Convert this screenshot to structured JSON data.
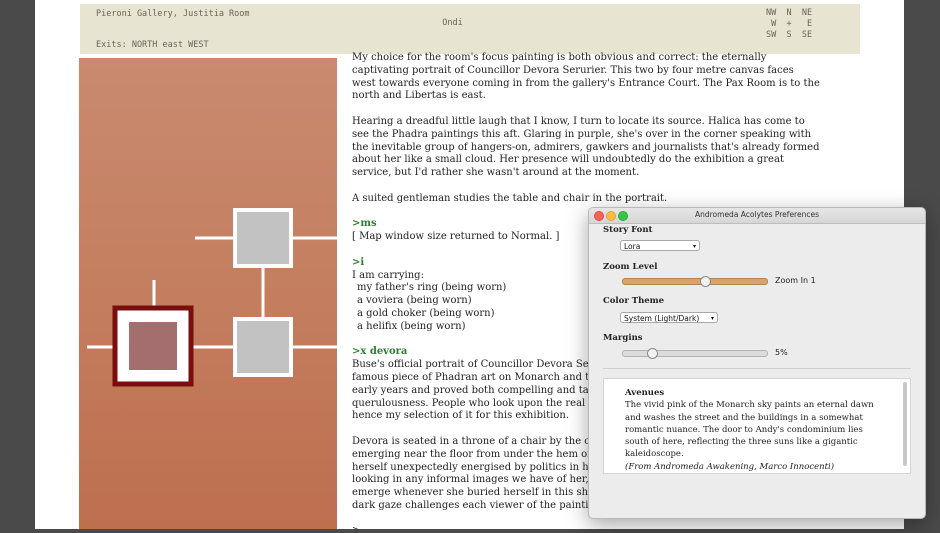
{
  "status": {
    "location": "Pieroni Gallery, Justitia Room",
    "time": "Ondi",
    "exits": "Exits: NORTH east WEST",
    "compass": [
      "NW  N  NE",
      " W  +   E",
      "SW  S  SE"
    ]
  },
  "story": {
    "p1": "My choice for the room's focus painting is both obvious and correct: the eternally captivating portrait of Councillor Devora Serurier. This two by four metre canvas faces west towards everyone coming in from the gallery's Entrance Court. The Pax Room is to the north and Libertas is east.",
    "p2": "Hearing a dreadful little laugh that I know, I turn to locate its source. Halica has come to see the Phadra paintings this aft. Glaring in purple, she's over in the corner speaking with the inevitable group of hangers-on, admirers, gawkers and journalists that's already formed about her like a small cloud. Her presence will undoubtedly do the exhibition a great service, but I'd rather she wasn't around at the moment.",
    "p3": "A suited gentleman studies the table and chair in the portrait.",
    "cmd1": ">ms",
    "resp1": "[ Map window size returned to Normal. ]",
    "cmd2": ">i",
    "inv_head": "I am carrying:",
    "inventory": [
      "my father's ring (being worn)",
      "a voviera (being worn)",
      "a gold choker (being worn)",
      "a helifix (being worn)"
    ],
    "cmd3": ">x devora",
    "devora1": [
      "Buse's official portrait of Councillor Devora Serurier, th",
      "famous piece of Phadran art on Monarch and the only f",
      "early years and proved both compelling and tasteful en",
      "querulousness. People who look upon the real painting",
      "hence my selection of it for this exhibition."
    ],
    "devora2": [
      "Devora is seated in a throne of a chair by the council tal",
      "emerging near the floor from under the hem of a specta",
      "herself unexpectedly energised by politics in her thirtie",
      "looking in any informal images we have of her, her true",
      "emerge whenever she buried herself in this showy cere",
      "dark gaze challenges each viewer of the painting direct"
    ],
    "prompt": ">"
  },
  "prefs": {
    "title": "Andromeda Acolytes Preferences",
    "story_font_label": "Story Font",
    "story_font_value": "Lora",
    "zoom_label": "Zoom Level",
    "zoom_value": "Zoom In 1",
    "zoom_fraction": 0.57,
    "theme_label": "Color Theme",
    "theme_value": "System (Light/Dark)",
    "margins_label": "Margins",
    "margins_value": "5%",
    "margins_fraction": 0.2,
    "preview_heading": "Avenues",
    "preview_body": "The vivid pink of the Monarch sky paints an eternal dawn and washes the street and the buildings in a somewhat romantic nuance. The door to Andy's condominium lies south of here, reflecting the three suns like a gigantic kaleidoscope.",
    "preview_credit": "(From Andromeda Awakening, Marco Innocenti)"
  },
  "colors": {
    "map_bg": "#c47e5f",
    "current_room": "#7a0d0d",
    "room_fill": "#c2c2c2",
    "command": "#2e7d32"
  }
}
